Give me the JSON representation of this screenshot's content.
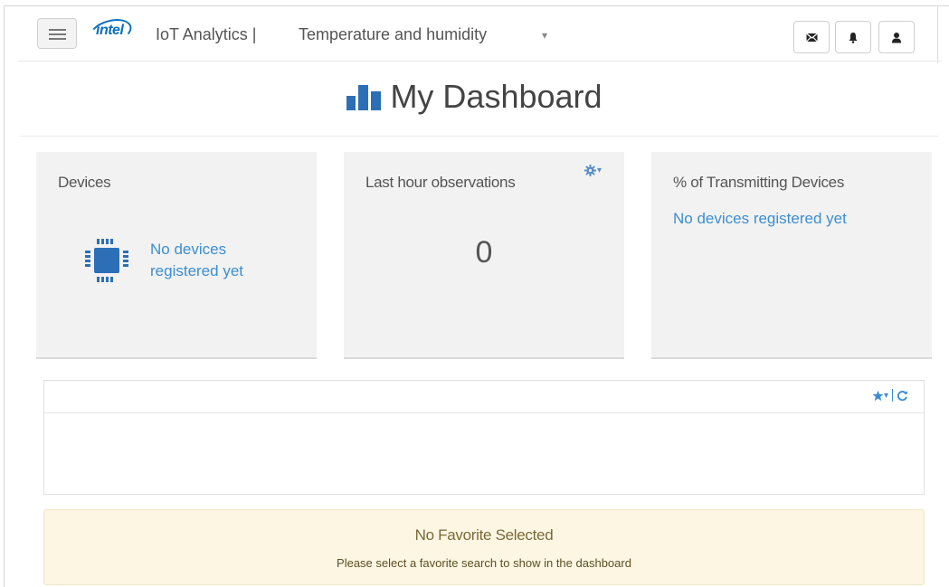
{
  "navbar": {
    "logo_text": "intel",
    "app_title": "IoT Analytics |",
    "account_name": "Temperature and humidity",
    "account_caret": "▾",
    "icons": {
      "menu": "hamburger-icon",
      "mail": "envelope-icon",
      "notifications": "bell-icon",
      "user": "user-icon"
    }
  },
  "dashboard": {
    "title": "My Dashboard",
    "title_icon": "bar-chart-icon"
  },
  "panels": {
    "devices": {
      "title": "Devices",
      "icon": "chip-icon",
      "link": "No devices registered yet"
    },
    "observations": {
      "title": "Last hour observations",
      "value": "0",
      "settings_icon": "gear-icon",
      "settings_caret": "▾"
    },
    "transmitting": {
      "title": "% of Transmitting Devices",
      "link": "No devices registered yet"
    }
  },
  "favorites": {
    "star_icon": "star-icon",
    "star_caret": "▾",
    "refresh_icon": "refresh-icon"
  },
  "alert": {
    "title": "No Favorite Selected",
    "message": "Please select a favorite search to show in the dashboard"
  },
  "colors": {
    "link": "#3c8ed1",
    "brand": "#0a6fbe",
    "panel_bg": "#f2f2f2",
    "alert_bg": "#fcf6e3"
  }
}
